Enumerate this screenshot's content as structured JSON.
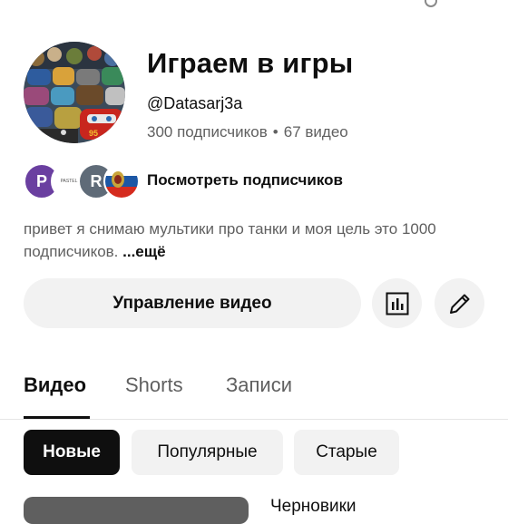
{
  "channel": {
    "title": "Играем в игры",
    "handle": "@Datasarj3a",
    "subscribers": "300 подписчиков",
    "separator": "•",
    "videos": "67 видео"
  },
  "subscribers_preview": {
    "avatars": [
      {
        "letter": "P",
        "color": "#6a3fa0"
      },
      {
        "letter": "PASTEL",
        "color": "#ffffff"
      },
      {
        "letter": "R",
        "color": "#5f6b78"
      },
      {
        "letter": "",
        "color": "#c8a43a"
      }
    ],
    "label": "Посмотреть подписчиков"
  },
  "description": {
    "text": "привет я снимаю мультики про танки и моя цель  это 1000 подписчиков. ",
    "more": "...ещё"
  },
  "actions": {
    "manage_videos": "Управление видео",
    "analytics_icon": "analytics-icon",
    "edit_icon": "pencil-icon"
  },
  "tabs": [
    {
      "label": "Видео",
      "active": true
    },
    {
      "label": "Shorts",
      "active": false
    },
    {
      "label": "Записи",
      "active": false
    }
  ],
  "filters": [
    {
      "label": "Новые",
      "active": true
    },
    {
      "label": "Популярные",
      "active": false
    },
    {
      "label": "Старые",
      "active": false
    }
  ],
  "list": {
    "first_item_title": "Черновики"
  }
}
